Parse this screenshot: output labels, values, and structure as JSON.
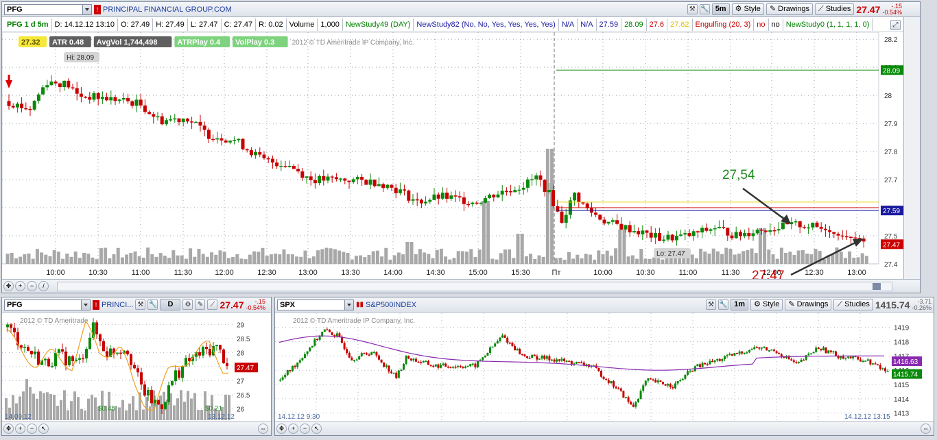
{
  "main": {
    "symbol": "PFG",
    "company": "PRINCIPAL FINANCIAL GROUP.COM",
    "timeframe_btn": "5m",
    "style_label": "Style",
    "drawings_label": "Drawings",
    "studies_label": "Studies",
    "last": "27.47",
    "change": "-.15",
    "change_pct": "-0.54%",
    "study_items": [
      "PFG 1 d 5m",
      "D: 14.12.12 13:10",
      "O: 27.49",
      "H: 27.49",
      "L: 27.47",
      "C: 27.47",
      "R: 0.02",
      "Volume",
      "1,000",
      "NewStudy49 (DAY)",
      "NewStudy82 (No, No, Yes, Yes, Yes, Yes)",
      "N/A",
      "N/A",
      "27.59",
      "28.09",
      "27.6",
      "27.62",
      "Engulfing (20, 3)",
      "no",
      "no",
      "NewStudy0 (1, 1, 1, 1, 0)"
    ],
    "study_colors": [
      "#008000",
      "#000",
      "#000",
      "#000",
      "#000",
      "#000",
      "#000",
      "#000",
      "#000",
      "#008000",
      "#1a1aa0",
      "#1a1aa0",
      "#1a1aa0",
      "#1a1aa0",
      "#008000",
      "#c00",
      "#e0c000",
      "#c00",
      "#c00",
      "#000",
      "#008000"
    ],
    "badges": [
      {
        "text": "27.32",
        "bg": "#f5e83a",
        "fg": "#5a5000"
      },
      {
        "text": "ATR 0.48",
        "bg": "#5f5f5f",
        "fg": "#fff"
      },
      {
        "text": "AvgVol 1,744,498",
        "bg": "#5f5f5f",
        "fg": "#fff"
      },
      {
        "text": "ATRPlay 0.4",
        "bg": "#7ed37e",
        "fg": "#fff"
      },
      {
        "text": "VolPlay 0.3",
        "bg": "#7ed37e",
        "fg": "#fff"
      }
    ],
    "copyright": "2012 © TD Ameritrade IP Company, Inc.",
    "hi_label": "Hi: 28.09",
    "lo_label": "Lo: 27.47",
    "annot_up": "27,54",
    "annot_down": "27,47",
    "price_ticks": [
      "28.2",
      "28.1",
      "28",
      "27.9",
      "27.8",
      "27.7",
      "27.6",
      "27.5",
      "27.4"
    ],
    "time_ticks": [
      "10:00",
      "10:30",
      "11:00",
      "11:30",
      "12:00",
      "12:30",
      "13:00",
      "13:30",
      "14:00",
      "14:30",
      "15:00",
      "15:30",
      "Пт",
      "10:00",
      "10:30",
      "11:00",
      "11:30",
      "12:00",
      "12:30",
      "13:00"
    ],
    "tag_green": "28.09",
    "tag_blue": "27.59",
    "tag_red": "27.47",
    "colors": {
      "up": "#0a8a0a",
      "down": "#c80000",
      "volume": "#a8a8a8"
    }
  },
  "left": {
    "symbol": "PFG",
    "company": "PRINCI...",
    "timeframe_btn": "D",
    "last": "27.47",
    "change": "-.15",
    "change_pct": "-0.54%",
    "copyright": "2012 © TD Ameritrade",
    "price_ticks": [
      "29",
      "28.5",
      "28",
      "27.5",
      "27",
      "26.5",
      "26"
    ],
    "tag": "27.47",
    "date_start": "14.09.12",
    "date_end": "13.12.12",
    "label1": "$0.45",
    "label2": "$0.21"
  },
  "right": {
    "symbol": "SPX",
    "company": "S&P500INDEX",
    "timeframe_btn": "1m",
    "style_label": "Style",
    "drawings_label": "Drawings",
    "studies_label": "Studies",
    "last": "1415.74",
    "change": "-3.71",
    "change_pct": "-0.26%",
    "copyright": "2012 © TD Ameritrade IP Company, Inc.",
    "price_ticks": [
      "1419",
      "1418",
      "1417",
      "1416",
      "1415",
      "1414",
      "1413"
    ],
    "tag_purple": "1416.63",
    "tag_green": "1415.74",
    "date_start": "14.12.12 9:30",
    "date_end": "14.12.12 13:15"
  }
}
